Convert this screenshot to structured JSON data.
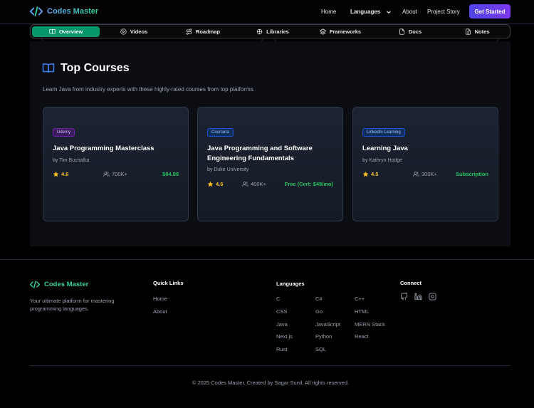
{
  "header": {
    "brand": "Codes Master",
    "nav": {
      "home": "Home",
      "languages": "Languages",
      "about": "About",
      "project_story": "Project Story"
    },
    "cta": "Get Started"
  },
  "tabs": [
    {
      "label": "Overview",
      "icon": "book-open-icon",
      "active": true
    },
    {
      "label": "Videos",
      "icon": "play-circle-icon",
      "active": false
    },
    {
      "label": "Roadmap",
      "icon": "route-icon",
      "active": false
    },
    {
      "label": "Libraries",
      "icon": "package-icon",
      "active": false
    },
    {
      "label": "Frameworks",
      "icon": "layers-icon",
      "active": false
    },
    {
      "label": "Docs",
      "icon": "file-icon",
      "active": false
    },
    {
      "label": "Notes",
      "icon": "file-text-icon",
      "active": false
    }
  ],
  "section": {
    "title": "Top Courses",
    "description": "Learn Java from industry experts with these highly-rated courses from top platforms."
  },
  "courses": [
    {
      "platform": "Udemy",
      "title": "Java Programming Masterclass",
      "author": "by Tim Buchalka",
      "rating": "4.6",
      "students": "700K+",
      "price": "$84.99"
    },
    {
      "platform": "Coursera",
      "title": "Java Programming and Software Engineering Fundamentals",
      "author": "by Duke University",
      "rating": "4.6",
      "students": "400K+",
      "price": "Free (Cert: $49/mo)"
    },
    {
      "platform": "LinkedIn Learning",
      "title": "Learning Java",
      "author": "by Kathryn Hodge",
      "rating": "4.5",
      "students": "300K+",
      "price": "Subscription"
    }
  ],
  "footer": {
    "brand": "Codes Master",
    "tagline": "Your ultimate platform for mastering programming languages.",
    "quick_links_title": "Quick Links",
    "quick_links": [
      "Home",
      "About"
    ],
    "languages_title": "Languages",
    "languages": [
      "C",
      "C#",
      "C++",
      "CSS",
      "Go",
      "HTML",
      "Java",
      "JavaScript",
      "MERN Stack",
      "Next.js",
      "Python",
      "React",
      "Rust",
      "SQL"
    ],
    "connect_title": "Connect",
    "social": [
      "github-icon",
      "linkedin-icon",
      "instagram-icon"
    ],
    "copyright": "© 2025 Codes Master. Created by Sagar Sunil. All rights reserved."
  },
  "colors": {
    "accent_green": "#059669",
    "brand_teal": "#34d399",
    "cta_purple": "#7c3aed",
    "star": "#fbbf24",
    "price": "#22c55e"
  }
}
